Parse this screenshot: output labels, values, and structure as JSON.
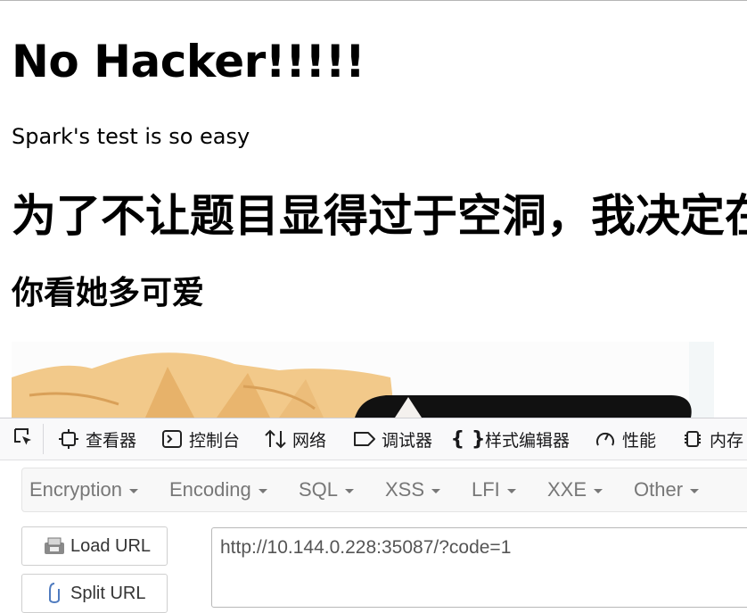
{
  "page": {
    "title": "No Hacker!!!!!",
    "paragraph": "Spark's test is so easy",
    "heading_cn": "为了不让题目显得过于空洞，我决定在",
    "subheading_cn": "你看她多可爱"
  },
  "devtools": {
    "tabs": [
      {
        "icon": "inspector-icon",
        "label": "查看器"
      },
      {
        "icon": "console-icon",
        "label": "控制台"
      },
      {
        "icon": "network-icon",
        "label": "网络"
      },
      {
        "icon": "debugger-icon",
        "label": "调试器"
      },
      {
        "icon": "style-editor-icon",
        "label": "样式编辑器"
      },
      {
        "icon": "performance-icon",
        "label": "性能"
      },
      {
        "icon": "memory-icon",
        "label": "内存"
      }
    ]
  },
  "hackbar": {
    "menus": [
      "Encryption",
      "Encoding",
      "SQL",
      "XSS",
      "LFI",
      "XXE",
      "Other"
    ],
    "load_url": "Load URL",
    "split_url": "Split URL",
    "url_value": "http://10.144.0.228:35087/?code=1"
  },
  "colors": {
    "hair": "#f2c98a",
    "hair_dark": "#e0a95a",
    "menu_text": "#777777",
    "devtools_bg": "#f9f9fa"
  }
}
